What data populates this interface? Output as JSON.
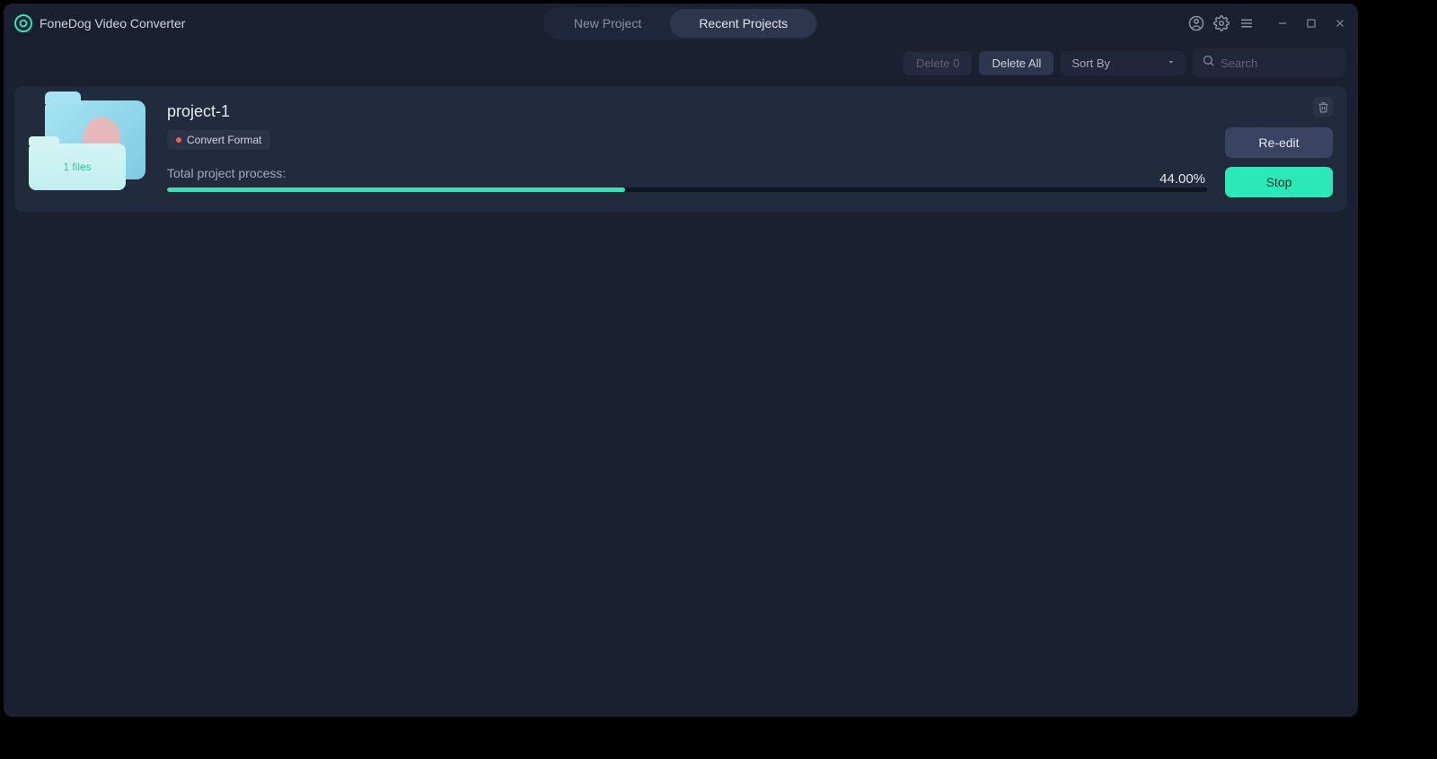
{
  "app": {
    "title": "FoneDog Video Converter"
  },
  "tabs": {
    "new_project": "New Project",
    "recent_projects": "Recent Projects"
  },
  "toolbar": {
    "delete_count_label": "Delete 0",
    "delete_all_label": "Delete All",
    "sort_by_label": "Sort By",
    "search_placeholder": "Search"
  },
  "project": {
    "name": "project-1",
    "files_label": "1 files",
    "tag_label": "Convert Format",
    "progress_label": "Total project process:",
    "progress_pct_label": "44.00%",
    "progress_pct": 44.0,
    "reedit_label": "Re-edit",
    "stop_label": "Stop"
  }
}
